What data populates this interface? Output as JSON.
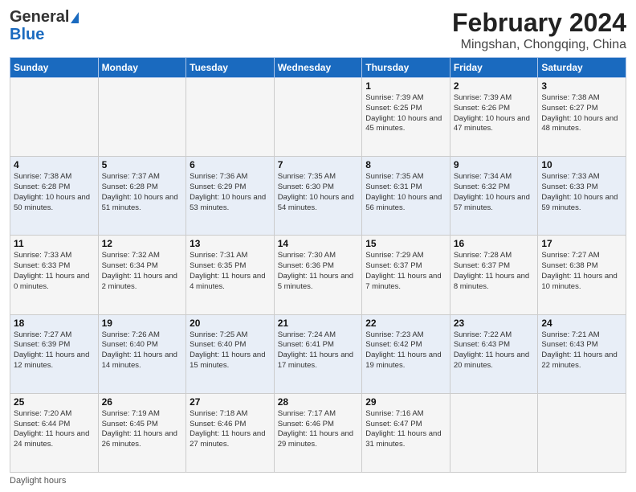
{
  "header": {
    "logo_general": "General",
    "logo_blue": "Blue",
    "title": "February 2024",
    "subtitle": "Mingshan, Chongqing, China"
  },
  "days_of_week": [
    "Sunday",
    "Monday",
    "Tuesday",
    "Wednesday",
    "Thursday",
    "Friday",
    "Saturday"
  ],
  "weeks": [
    [
      {
        "day": "",
        "info": ""
      },
      {
        "day": "",
        "info": ""
      },
      {
        "day": "",
        "info": ""
      },
      {
        "day": "",
        "info": ""
      },
      {
        "day": "1",
        "info": "Sunrise: 7:39 AM\nSunset: 6:25 PM\nDaylight: 10 hours and 45 minutes."
      },
      {
        "day": "2",
        "info": "Sunrise: 7:39 AM\nSunset: 6:26 PM\nDaylight: 10 hours and 47 minutes."
      },
      {
        "day": "3",
        "info": "Sunrise: 7:38 AM\nSunset: 6:27 PM\nDaylight: 10 hours and 48 minutes."
      }
    ],
    [
      {
        "day": "4",
        "info": "Sunrise: 7:38 AM\nSunset: 6:28 PM\nDaylight: 10 hours and 50 minutes."
      },
      {
        "day": "5",
        "info": "Sunrise: 7:37 AM\nSunset: 6:28 PM\nDaylight: 10 hours and 51 minutes."
      },
      {
        "day": "6",
        "info": "Sunrise: 7:36 AM\nSunset: 6:29 PM\nDaylight: 10 hours and 53 minutes."
      },
      {
        "day": "7",
        "info": "Sunrise: 7:35 AM\nSunset: 6:30 PM\nDaylight: 10 hours and 54 minutes."
      },
      {
        "day": "8",
        "info": "Sunrise: 7:35 AM\nSunset: 6:31 PM\nDaylight: 10 hours and 56 minutes."
      },
      {
        "day": "9",
        "info": "Sunrise: 7:34 AM\nSunset: 6:32 PM\nDaylight: 10 hours and 57 minutes."
      },
      {
        "day": "10",
        "info": "Sunrise: 7:33 AM\nSunset: 6:33 PM\nDaylight: 10 hours and 59 minutes."
      }
    ],
    [
      {
        "day": "11",
        "info": "Sunrise: 7:33 AM\nSunset: 6:33 PM\nDaylight: 11 hours and 0 minutes."
      },
      {
        "day": "12",
        "info": "Sunrise: 7:32 AM\nSunset: 6:34 PM\nDaylight: 11 hours and 2 minutes."
      },
      {
        "day": "13",
        "info": "Sunrise: 7:31 AM\nSunset: 6:35 PM\nDaylight: 11 hours and 4 minutes."
      },
      {
        "day": "14",
        "info": "Sunrise: 7:30 AM\nSunset: 6:36 PM\nDaylight: 11 hours and 5 minutes."
      },
      {
        "day": "15",
        "info": "Sunrise: 7:29 AM\nSunset: 6:37 PM\nDaylight: 11 hours and 7 minutes."
      },
      {
        "day": "16",
        "info": "Sunrise: 7:28 AM\nSunset: 6:37 PM\nDaylight: 11 hours and 8 minutes."
      },
      {
        "day": "17",
        "info": "Sunrise: 7:27 AM\nSunset: 6:38 PM\nDaylight: 11 hours and 10 minutes."
      }
    ],
    [
      {
        "day": "18",
        "info": "Sunrise: 7:27 AM\nSunset: 6:39 PM\nDaylight: 11 hours and 12 minutes."
      },
      {
        "day": "19",
        "info": "Sunrise: 7:26 AM\nSunset: 6:40 PM\nDaylight: 11 hours and 14 minutes."
      },
      {
        "day": "20",
        "info": "Sunrise: 7:25 AM\nSunset: 6:40 PM\nDaylight: 11 hours and 15 minutes."
      },
      {
        "day": "21",
        "info": "Sunrise: 7:24 AM\nSunset: 6:41 PM\nDaylight: 11 hours and 17 minutes."
      },
      {
        "day": "22",
        "info": "Sunrise: 7:23 AM\nSunset: 6:42 PM\nDaylight: 11 hours and 19 minutes."
      },
      {
        "day": "23",
        "info": "Sunrise: 7:22 AM\nSunset: 6:43 PM\nDaylight: 11 hours and 20 minutes."
      },
      {
        "day": "24",
        "info": "Sunrise: 7:21 AM\nSunset: 6:43 PM\nDaylight: 11 hours and 22 minutes."
      }
    ],
    [
      {
        "day": "25",
        "info": "Sunrise: 7:20 AM\nSunset: 6:44 PM\nDaylight: 11 hours and 24 minutes."
      },
      {
        "day": "26",
        "info": "Sunrise: 7:19 AM\nSunset: 6:45 PM\nDaylight: 11 hours and 26 minutes."
      },
      {
        "day": "27",
        "info": "Sunrise: 7:18 AM\nSunset: 6:46 PM\nDaylight: 11 hours and 27 minutes."
      },
      {
        "day": "28",
        "info": "Sunrise: 7:17 AM\nSunset: 6:46 PM\nDaylight: 11 hours and 29 minutes."
      },
      {
        "day": "29",
        "info": "Sunrise: 7:16 AM\nSunset: 6:47 PM\nDaylight: 11 hours and 31 minutes."
      },
      {
        "day": "",
        "info": ""
      },
      {
        "day": "",
        "info": ""
      }
    ]
  ],
  "footer": {
    "note": "Daylight hours"
  }
}
